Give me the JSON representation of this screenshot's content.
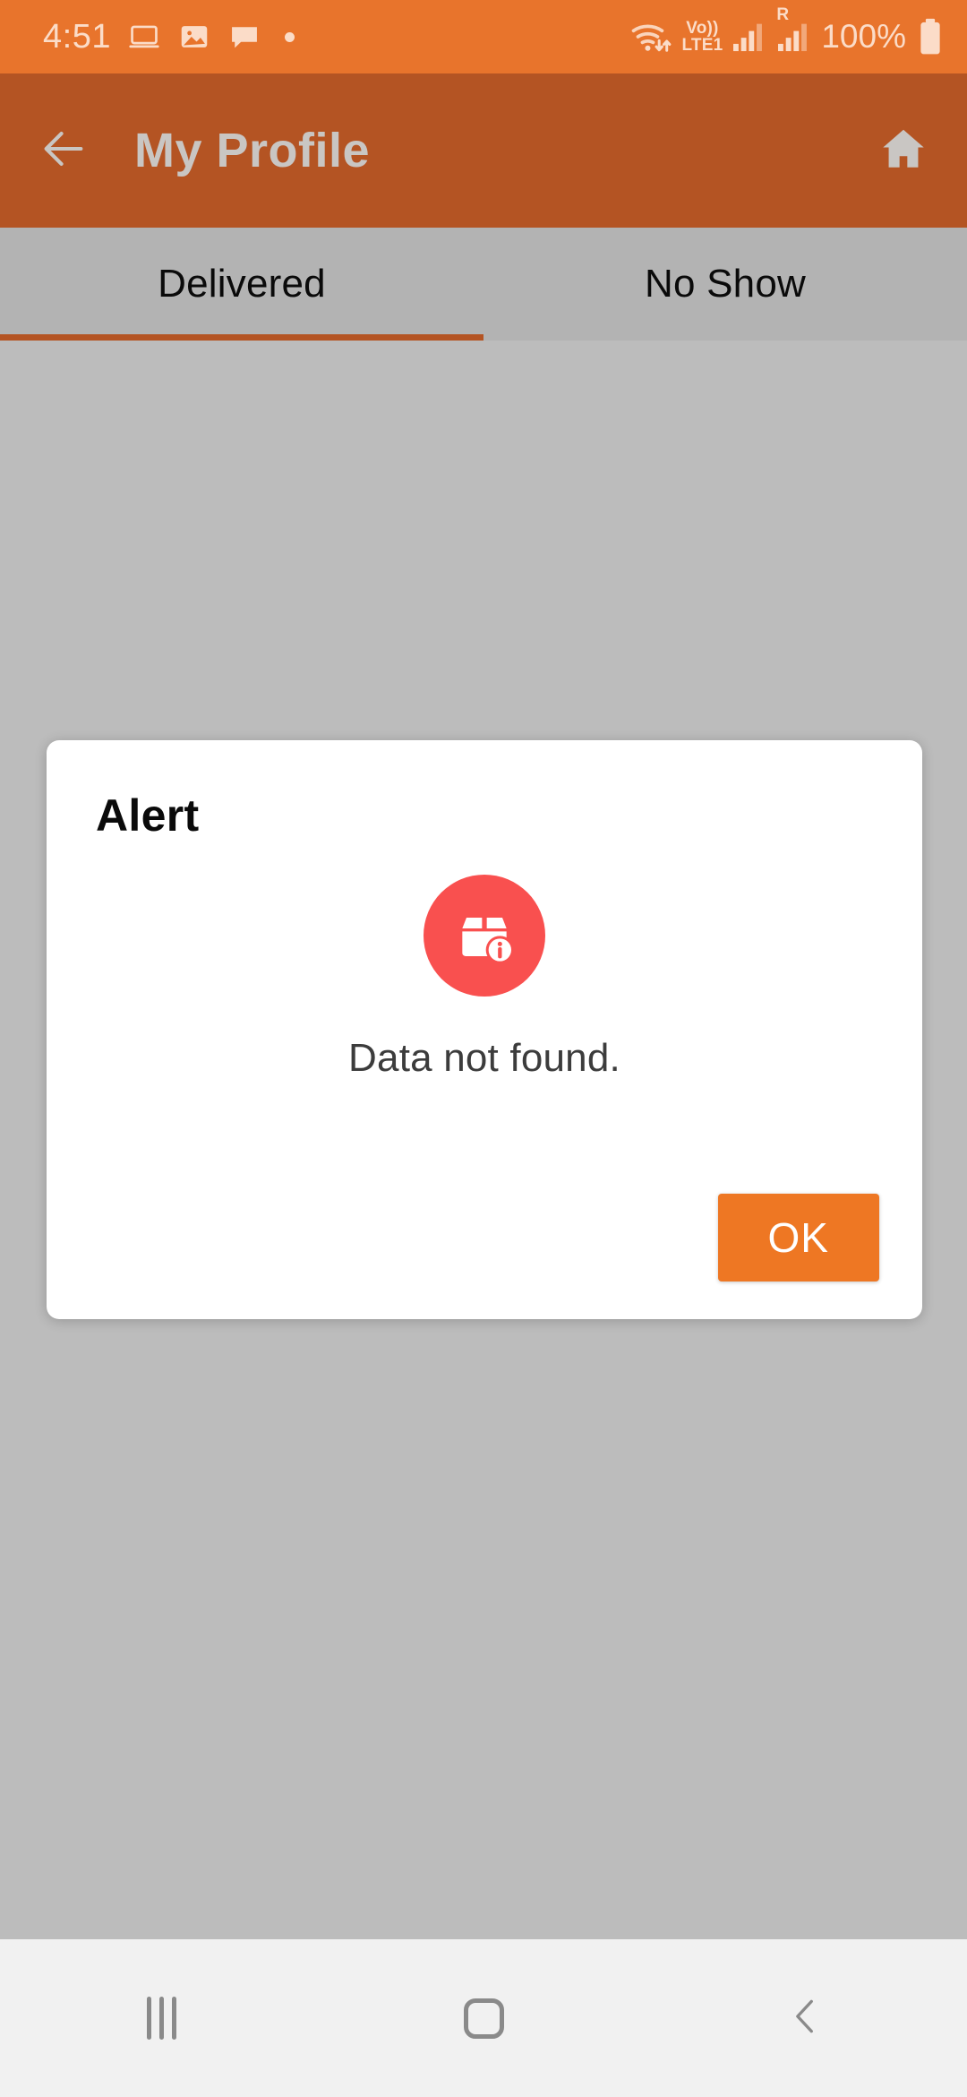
{
  "status_bar": {
    "time": "4:51",
    "left_icons": [
      "laptop-icon",
      "gallery-icon",
      "chat-bubble-icon",
      "notification-dot"
    ],
    "wifi_icon": "wifi-with-data-arrows-icon",
    "volte_line1": "Vo))",
    "volte_line2": "LTE1",
    "signal_icon": "signal-bars-icon",
    "roaming_label": "R",
    "roaming_signal_icon": "signal-bars-icon",
    "battery_percent": "100%",
    "battery_icon": "battery-full-icon",
    "background_color": "#E8742C",
    "foreground_color": "#FBDCC8"
  },
  "app_bar": {
    "back_icon": "back-arrow-icon",
    "title": "My Profile",
    "home_icon": "home-icon",
    "background_color": "#B45423",
    "title_color": "#C9C6C3"
  },
  "tabs": {
    "items": [
      {
        "label": "Delivered",
        "active": true
      },
      {
        "label": "No Show",
        "active": false
      }
    ],
    "indicator_color": "#B45423",
    "background_color": "#B3B3B3"
  },
  "content": {
    "background_color": "#BCBCBC",
    "empty": true
  },
  "dialog": {
    "title": "Alert",
    "icon": "package-info-icon",
    "icon_background_color": "#F9504F",
    "message": "Data not found.",
    "ok_label": "OK",
    "ok_background_color": "#EE7723",
    "background_color": "#FFFFFF"
  },
  "nav_bar": {
    "recents_icon": "recents-icon",
    "home_icon": "home-square-icon",
    "back_icon": "back-chevron-icon",
    "background_color": "#F1F1F1",
    "icon_color": "#8A8A8A"
  }
}
